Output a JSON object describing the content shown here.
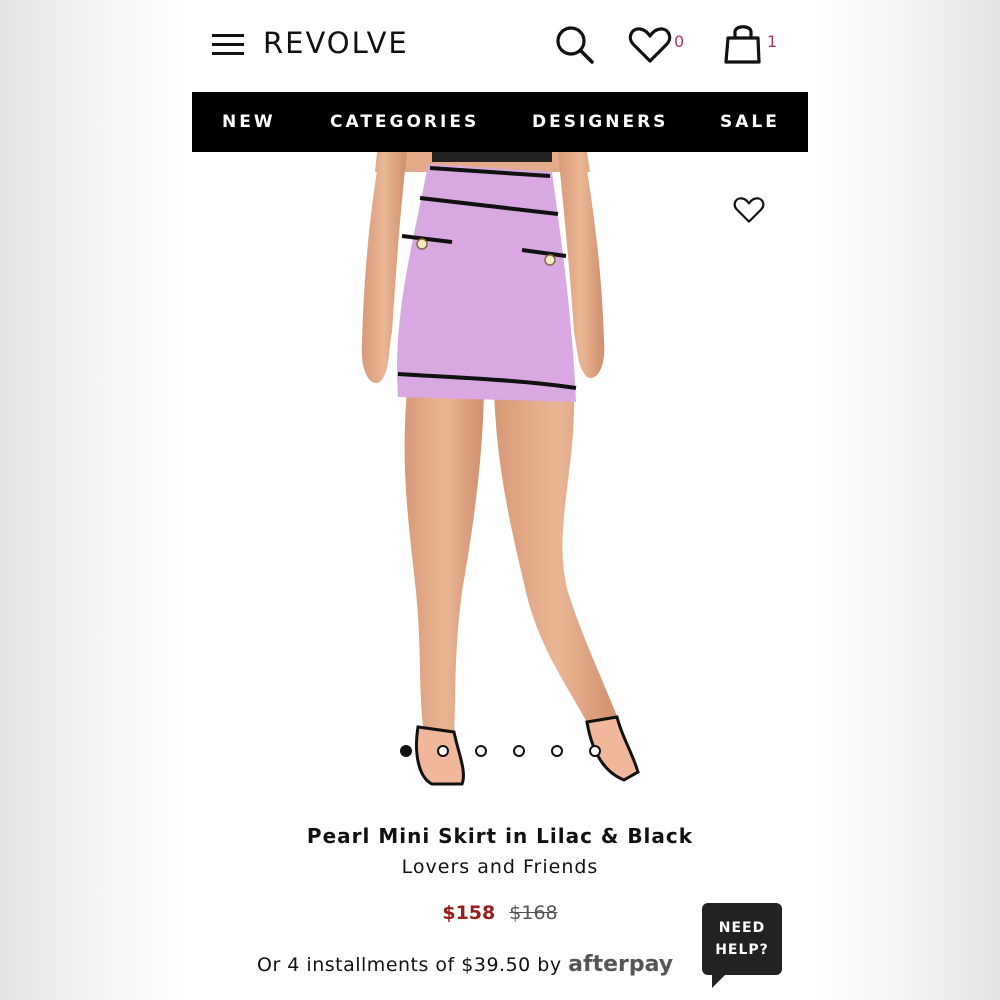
{
  "header": {
    "logo": "REVOLVE",
    "wishlist_count": "0",
    "bag_count": "1"
  },
  "nav": {
    "items": [
      "NEW",
      "CATEGORIES",
      "DESIGNERS",
      "SALE"
    ]
  },
  "product": {
    "name": "Pearl Mini Skirt in Lilac & Black",
    "brand": "Lovers and Friends",
    "price_sale": "$158",
    "price_original": "$168",
    "installments_text": "Or 4 installments of $39.50 by",
    "installments_provider": "afterpay",
    "image_count": 6,
    "active_image": 1
  },
  "help": {
    "line1": "NEED",
    "line2": "HELP?"
  },
  "colors": {
    "accent_count": "#b0306b",
    "sale_price": "#9b1b1b",
    "skirt": "#d9a8e2",
    "trim": "#111111"
  },
  "icons": [
    "menu-icon",
    "search-icon",
    "heart-icon",
    "bag-icon",
    "wishlist-heart-icon"
  ]
}
